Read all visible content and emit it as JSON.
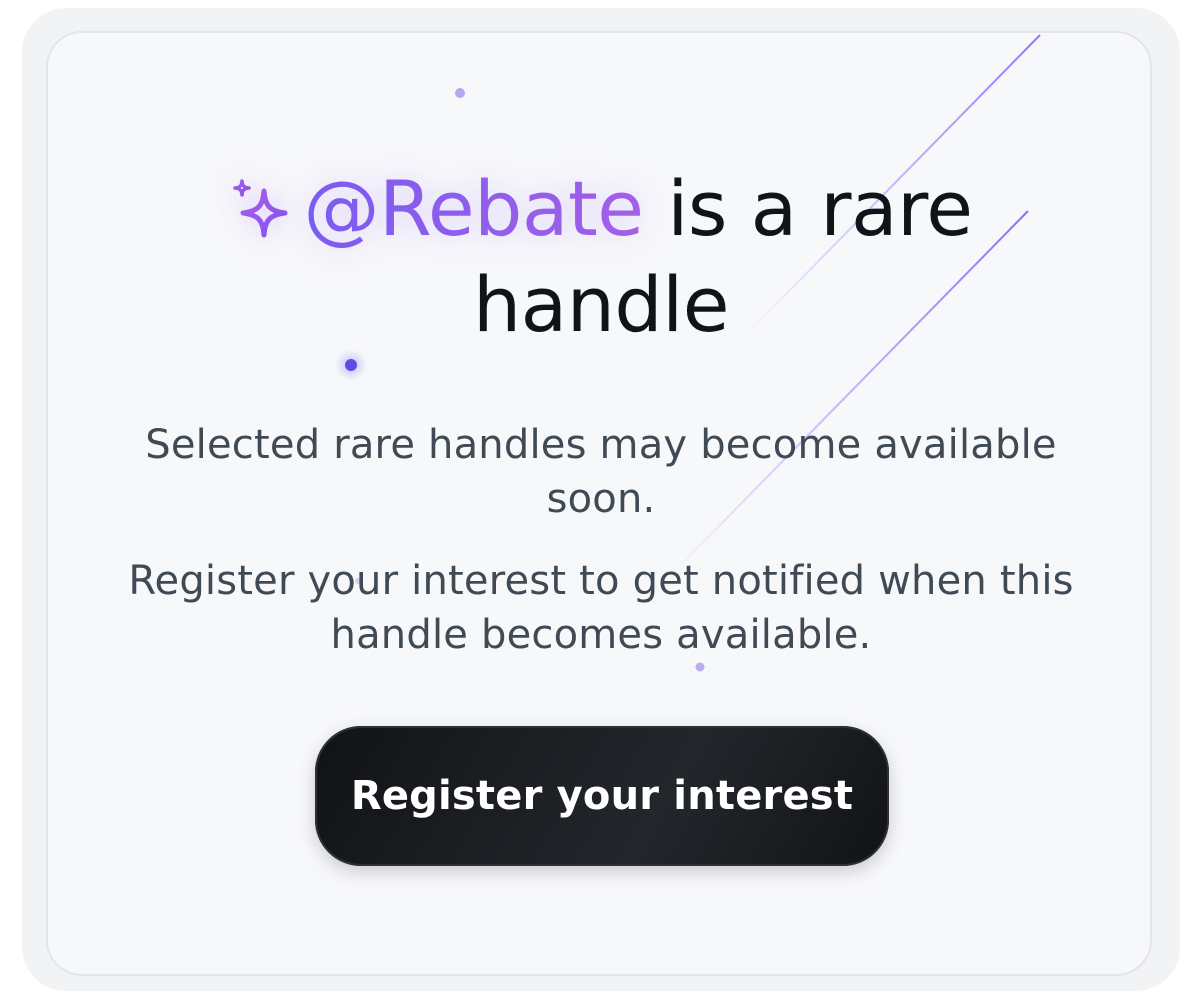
{
  "headline": {
    "handle": "@Rebate",
    "line1_rest": " is a rare",
    "line2": "handle",
    "sparkle_icon": "sparkle-icon"
  },
  "description": {
    "paragraph1": "Selected rare handles may become available soon.",
    "paragraph2": "Register your interest to get notified when this handle becomes available."
  },
  "cta": {
    "label": "Register your interest"
  },
  "colors": {
    "accent": "#8a5cf0",
    "text_primary": "#0f1419",
    "text_secondary": "#3f4a55",
    "button_bg": "#16181c",
    "card_bg": "#f7f8fa"
  }
}
